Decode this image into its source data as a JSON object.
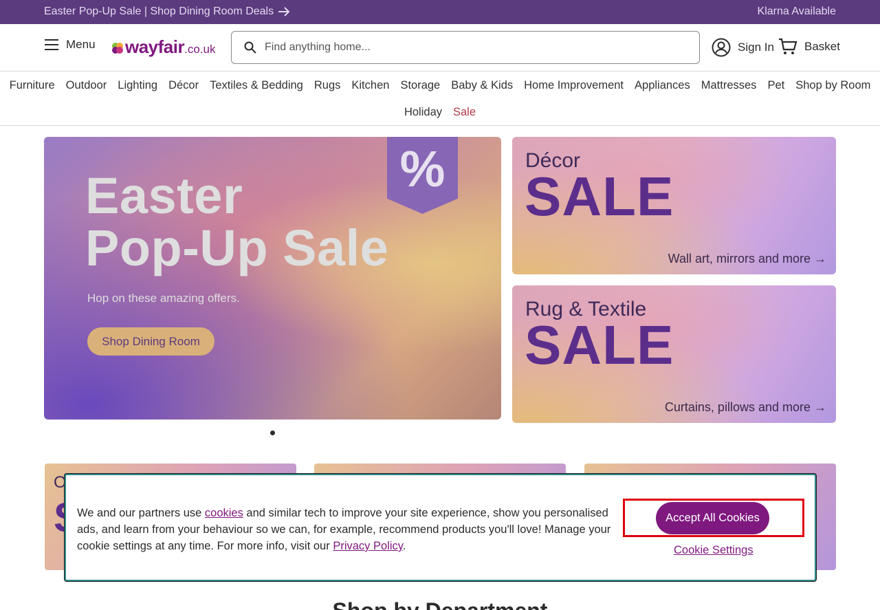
{
  "topbar": {
    "promo": "Easter Pop-Up Sale | Shop Dining Room Deals",
    "klarna": "Klarna Available"
  },
  "header": {
    "menu_label": "Menu",
    "logo_word": "wayfair",
    "logo_tld": ".co.uk",
    "search_placeholder": "Find anything home...",
    "sign_in": "Sign In",
    "basket": "Basket"
  },
  "nav": {
    "row1": [
      "Furniture",
      "Outdoor",
      "Lighting",
      "Décor",
      "Textiles & Bedding",
      "Rugs",
      "Kitchen",
      "Storage",
      "Baby & Kids",
      "Home Improvement",
      "Appliances",
      "Mattresses",
      "Pet",
      "Shop by Room"
    ],
    "row2": [
      "Holiday",
      "Sale"
    ]
  },
  "hero": {
    "badge": "%",
    "title_line1": "Easter",
    "title_line2": "Pop-Up Sale",
    "subtitle": "Hop on these amazing offers.",
    "cta": "Shop Dining Room"
  },
  "promos": [
    {
      "kicker": "Décor",
      "big": "SALE",
      "link": "Wall art, mirrors and more →"
    },
    {
      "kicker": "Rug & Textile",
      "big": "SALE",
      "link": "Curtains, pillows and more →"
    }
  ],
  "tiles": [
    {
      "letter": "O",
      "big": "S"
    },
    {
      "letter": "",
      "big": ""
    },
    {
      "letter": "",
      "big": ""
    }
  ],
  "section_heading": "Shop by Department",
  "cookie": {
    "text_before": "We and our partners use ",
    "cookies_link": "cookies",
    "text_middle": " and similar tech to improve your site experience, show you personalised ads, and learn from your behaviour so we can, for example, recommend products you'll love! Manage your cookie settings at any time. For more info, visit our ",
    "privacy_link": "Privacy Policy",
    "text_after": ".",
    "accept": "Accept All Cookies",
    "settings": "Cookie Settings"
  },
  "colors": {
    "brand": "#7f187f",
    "topbar": "#5c3a7e",
    "sale": "#b03a4a",
    "highlight": "#e00010"
  }
}
